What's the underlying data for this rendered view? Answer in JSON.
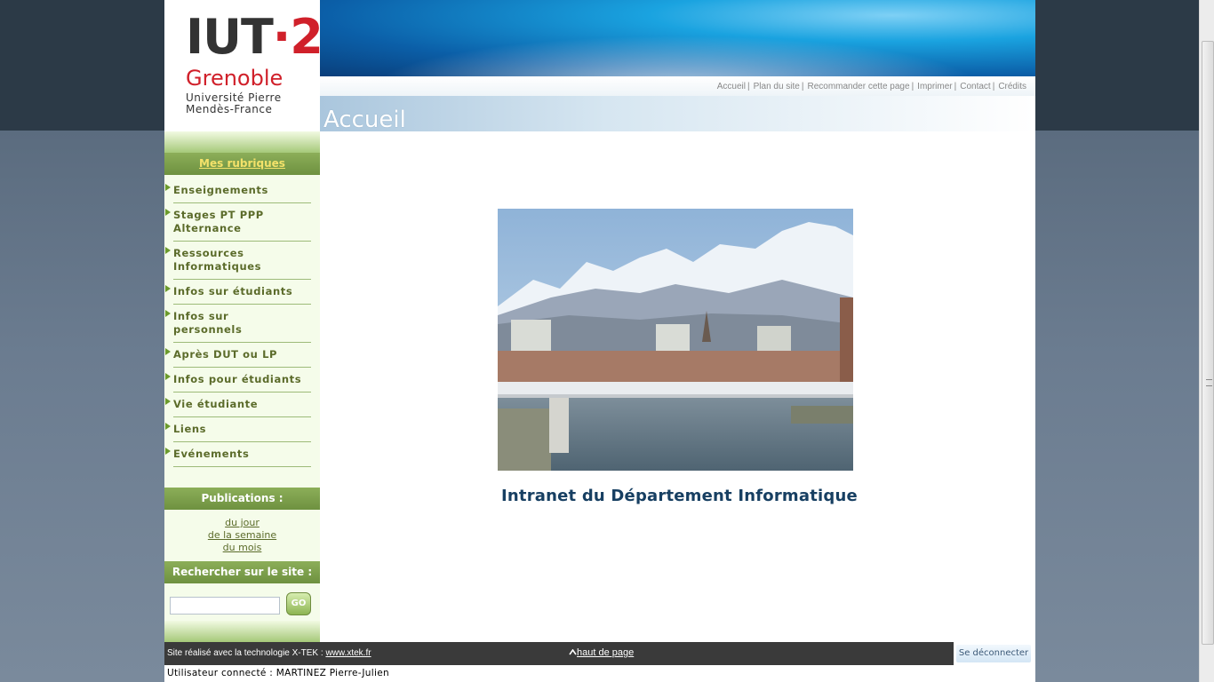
{
  "logo": {
    "iut": "IUT",
    "dot": "·",
    "number": "2",
    "city": "Grenoble",
    "university_line1": "Université Pierre",
    "university_line2": "Mendès-France"
  },
  "top_links": [
    "Accueil",
    "Plan du site",
    "Recommander cette page",
    "Imprimer",
    "Contact",
    "Crédits"
  ],
  "top_links_separator": "|",
  "page_title": "Accueil",
  "sidebar": {
    "rubriques_heading": "Mes rubriques",
    "menu": [
      {
        "line1": "Enseignements",
        "line2": ""
      },
      {
        "line1": "Stages PT PPP",
        "line2": "Alternance"
      },
      {
        "line1": "Ressources",
        "line2": "Informatiques"
      },
      {
        "line1": "Infos sur étudiants",
        "line2": ""
      },
      {
        "line1": "Infos sur",
        "line2": "personnels"
      },
      {
        "line1": "Après DUT ou LP",
        "line2": ""
      },
      {
        "line1": "Infos pour étudiants",
        "line2": ""
      },
      {
        "line1": "Vie étudiante",
        "line2": ""
      },
      {
        "line1": "Liens",
        "line2": ""
      },
      {
        "line1": "Evénements",
        "line2": ""
      }
    ],
    "publications_heading": "Publications :",
    "publications": [
      "du jour",
      "de la semaine",
      "du mois"
    ],
    "search_heading": "Rechercher sur le site :",
    "search_value": "",
    "go_label": "GO"
  },
  "main": {
    "heading": "Intranet du Département Informatique"
  },
  "footer": {
    "credit_text": "Site réalisé avec la technologie X-TEK :",
    "credit_link": "www.xtek.fr",
    "top_link": "haut de page",
    "logout_label": "Se déconnecter",
    "user_line": "Utilisateur connecté : MARTINEZ Pierre-Julien"
  },
  "colors": {
    "sidebar_bg": "#f5fcea",
    "sidebar_head": "#7a9c4a",
    "menu_text": "#5b6b2a",
    "heading_blue": "#173f62",
    "footer_bg": "#3a3a3a"
  }
}
